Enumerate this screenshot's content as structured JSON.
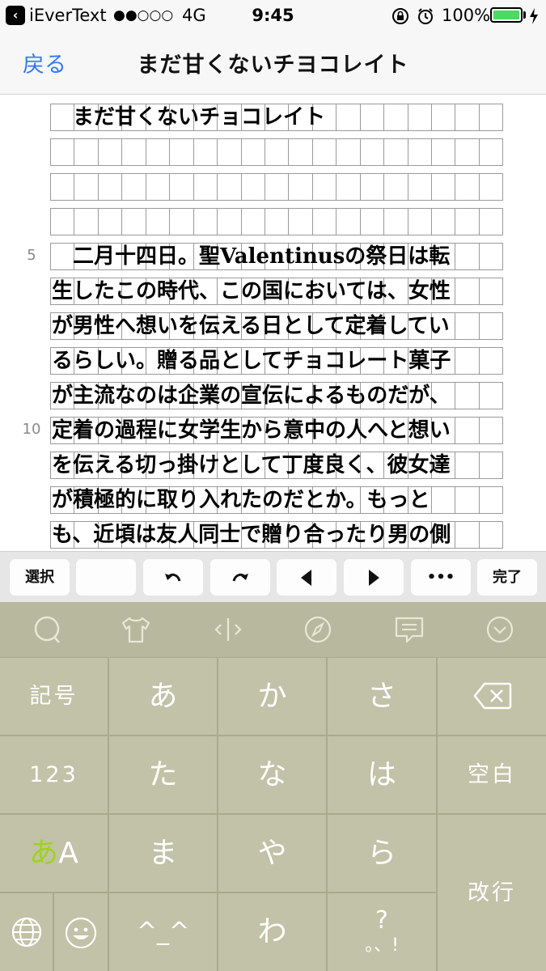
{
  "status_bar": {
    "app_name": "iEverText",
    "signal": "●●○○○",
    "network": "4G",
    "time": "9:45",
    "battery": "100%",
    "battery_color": "#4cd964"
  },
  "nav": {
    "back_label": "戻る",
    "title": "まだ甘くないチヨコレイト",
    "accent_color": "#3478f6"
  },
  "manuscript": {
    "cells_per_row": 19,
    "line_numbers": {
      "row_5": "5",
      "row_10": "10"
    },
    "lines": [
      "　まだ甘くないチョコレイト",
      "",
      "",
      "",
      "　二月十四日。聖Valentinusの祭日は転",
      "生したこの時代、この国においては、女性",
      "が男性へ想いを伝える日として定着してい",
      "るらしい。贈る品としてチョコレート菓子",
      "が主流なのは企業の宣伝によるものだが、",
      "定着の過程に女学生から意中の人へと想い",
      "を伝える切っ掛けとして丁度良く、彼女達",
      "が積極的に取り入れたのだとか。もっと",
      "も、近頃は友人同士で贈り合ったり男の側"
    ]
  },
  "toolbar": {
    "select": "選択",
    "blank": "",
    "undo_icon": "undo-icon",
    "redo_icon": "redo-icon",
    "left_icon": "caret-left-icon",
    "right_icon": "caret-right-icon",
    "more": "•••",
    "done": "完了"
  },
  "keyboard": {
    "top_icons": [
      "chat-bubble-icon",
      "tshirt-icon",
      "cursor-move-icon",
      "compass-icon",
      "message-icon",
      "chevron-down-icon"
    ],
    "symbols": "記号",
    "numbers": "123",
    "kana_a": "あ",
    "kana_ka": "か",
    "kana_sa": "さ",
    "kana_ta": "た",
    "kana_na": "な",
    "kana_ha": "は",
    "kana_ma": "ま",
    "kana_ya": "や",
    "kana_ra": "ら",
    "kana_wa": "わ",
    "face": "^_^",
    "punct_top": "?",
    "punct_bottom": "。、!",
    "mode_a": "あ",
    "mode_A": "A",
    "mode_accent": "#9fd11f",
    "space": "空白",
    "enter": "改行"
  }
}
